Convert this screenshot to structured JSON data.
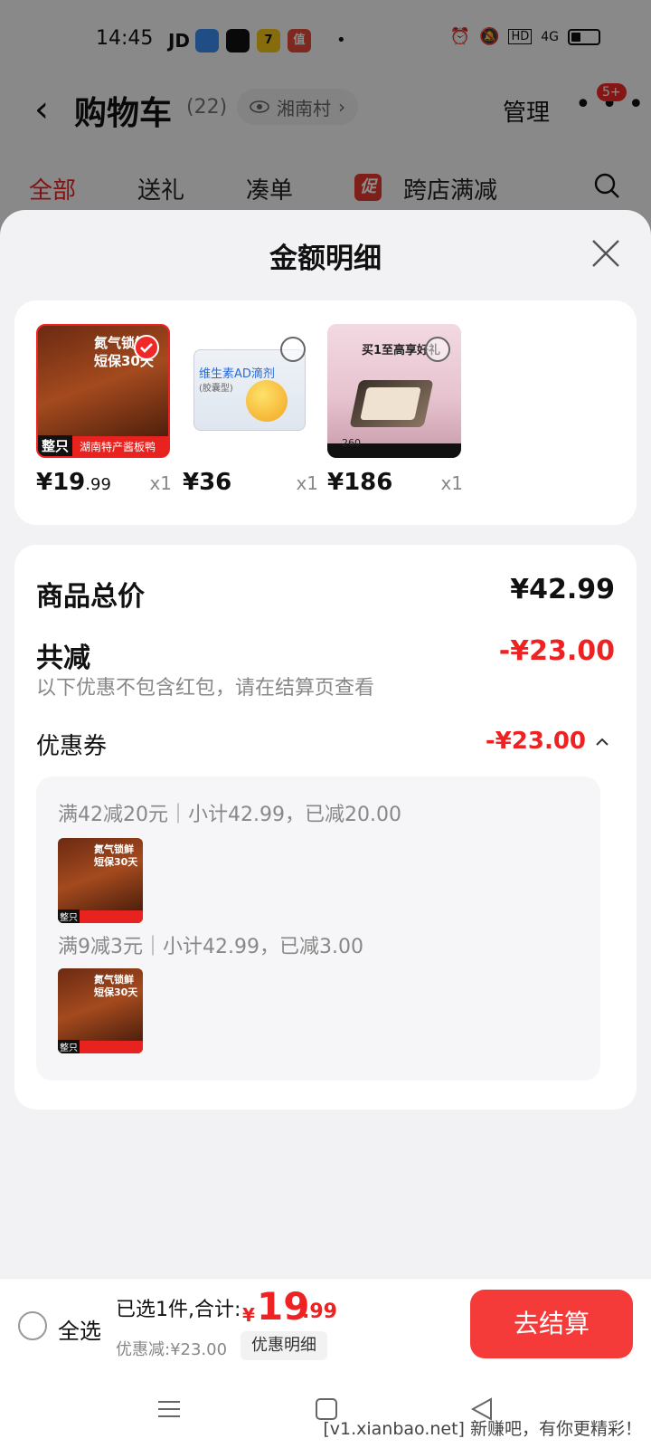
{
  "status_bar": {
    "time": "14:45",
    "apps": [
      "JD",
      "",
      "",
      "7",
      "值"
    ],
    "network": "4G",
    "hd": "HD",
    "dot": "•"
  },
  "nav": {
    "title": "购物车",
    "count": "(22)",
    "location": "湘南村",
    "manage": "管理",
    "badge": "5+"
  },
  "tabs": [
    "全部",
    "送礼",
    "凑单",
    "跨店满减"
  ],
  "promo_tag": "促",
  "sheet": {
    "title": "金额明细",
    "items": [
      {
        "price_main": "¥19",
        "price_dec": ".99",
        "qty": "x1",
        "thumb_text1": "氮气锁鲜",
        "thumb_text2": "短保30天",
        "thumb_tag": "整只",
        "thumb_banner": "湖南特产酱板鸭",
        "checked": true
      },
      {
        "price_main": "¥36",
        "price_dec": "",
        "qty": "x1",
        "thumb_text1": "维生素AD滴剂",
        "thumb_text2": "(胶囊型)",
        "thumb_tag": "",
        "thumb_banner": "",
        "checked": false
      },
      {
        "price_main": "¥186",
        "price_dec": "",
        "qty": "x1",
        "thumb_text1": "买1至高享好礼",
        "thumb_text2": "260",
        "thumb_tag": "",
        "thumb_banner": "",
        "checked": false
      }
    ],
    "summary": {
      "total_label": "商品总价",
      "total_value": "¥42.99",
      "reduce_label": "共减",
      "reduce_value": "-¥23.00",
      "note": "以下优惠不包含红包，请在结算页查看",
      "coupon_label": "优惠券",
      "coupon_value": "-¥23.00",
      "coupon_lines": [
        "满42减20元｜小计42.99，已减20.00",
        "满9减3元｜小计42.99，已减3.00"
      ]
    }
  },
  "bottom_bar": {
    "select_all": "全选",
    "selected_text": "已选1件,合计:",
    "currency": "¥",
    "total_int": "19",
    "total_dec": ".99",
    "discount_text": "优惠减:¥23.00",
    "detail_button": "优惠明细",
    "checkout": "去结算"
  },
  "watermark": "[v1.xianbao.net] 新赚吧，有你更精彩！",
  "colors": {
    "accent_red": "#ee2222",
    "checkout_red": "#f53a3a",
    "sheet_bg": "#f2f2f4"
  }
}
